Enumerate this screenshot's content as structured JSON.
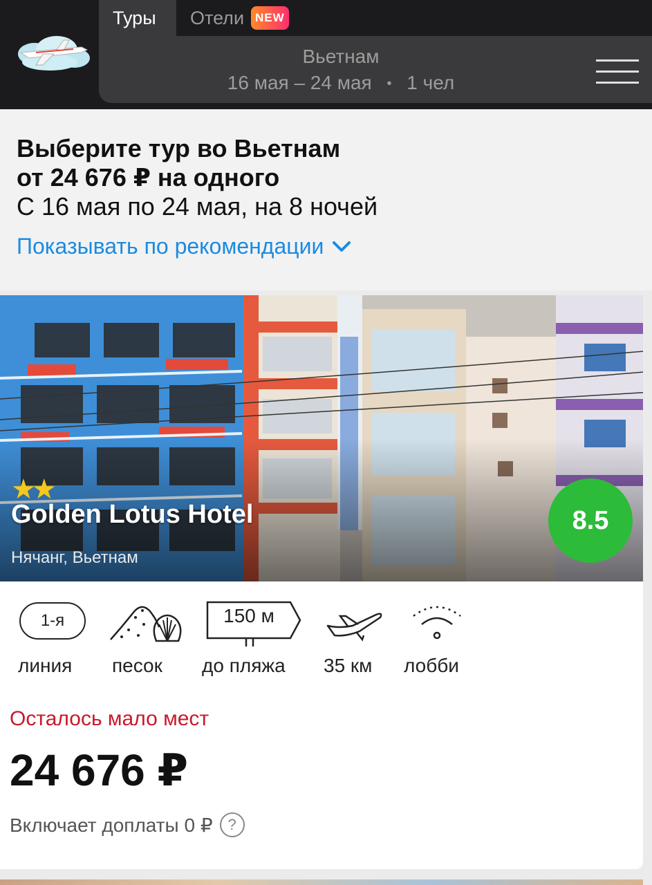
{
  "header": {
    "tabs": [
      {
        "label": "Туры",
        "active": true
      },
      {
        "label": "Отели",
        "badge": "NEW"
      }
    ],
    "search": {
      "destination": "Вьетнам",
      "dates": "16 мая – 24 мая",
      "separator": "•",
      "guests": "1 чел"
    },
    "logo_icon": "airplane-clouds-logo",
    "menu_icon": "hamburger-menu-icon"
  },
  "summary": {
    "title_line1": "Выберите тур во Вьетнам",
    "title_line2": "от 24 676 ₽ на одного",
    "dates_line": "С 16 мая по 24 мая, на 8 ночей",
    "sort_label": "Показывать по рекомендации",
    "sort_icon": "chevron-down-icon",
    "link_color": "#1a8be0"
  },
  "hotel": {
    "stars": 2,
    "stars_glyph": "★★",
    "name": "Golden Lotus Hotel",
    "location": "Нячанг, Вьетнам",
    "rating": "8.5",
    "rating_color": "#2dbb3a",
    "features": [
      {
        "icon": "line-pill-icon",
        "value": "1-я",
        "label": "линия"
      },
      {
        "icon": "sand-shell-icon",
        "label": "песок"
      },
      {
        "icon": "signpost-icon",
        "value": "150 м",
        "label": "до пляжа"
      },
      {
        "icon": "airplane-icon",
        "label": "35 км"
      },
      {
        "icon": "wifi-icon",
        "label": "лобби"
      }
    ],
    "availability": "Осталось мало мест",
    "availability_color": "#c8192b",
    "price": "24 676 ₽",
    "fees": "Включает доплаты 0 ₽",
    "help_icon": "?"
  }
}
